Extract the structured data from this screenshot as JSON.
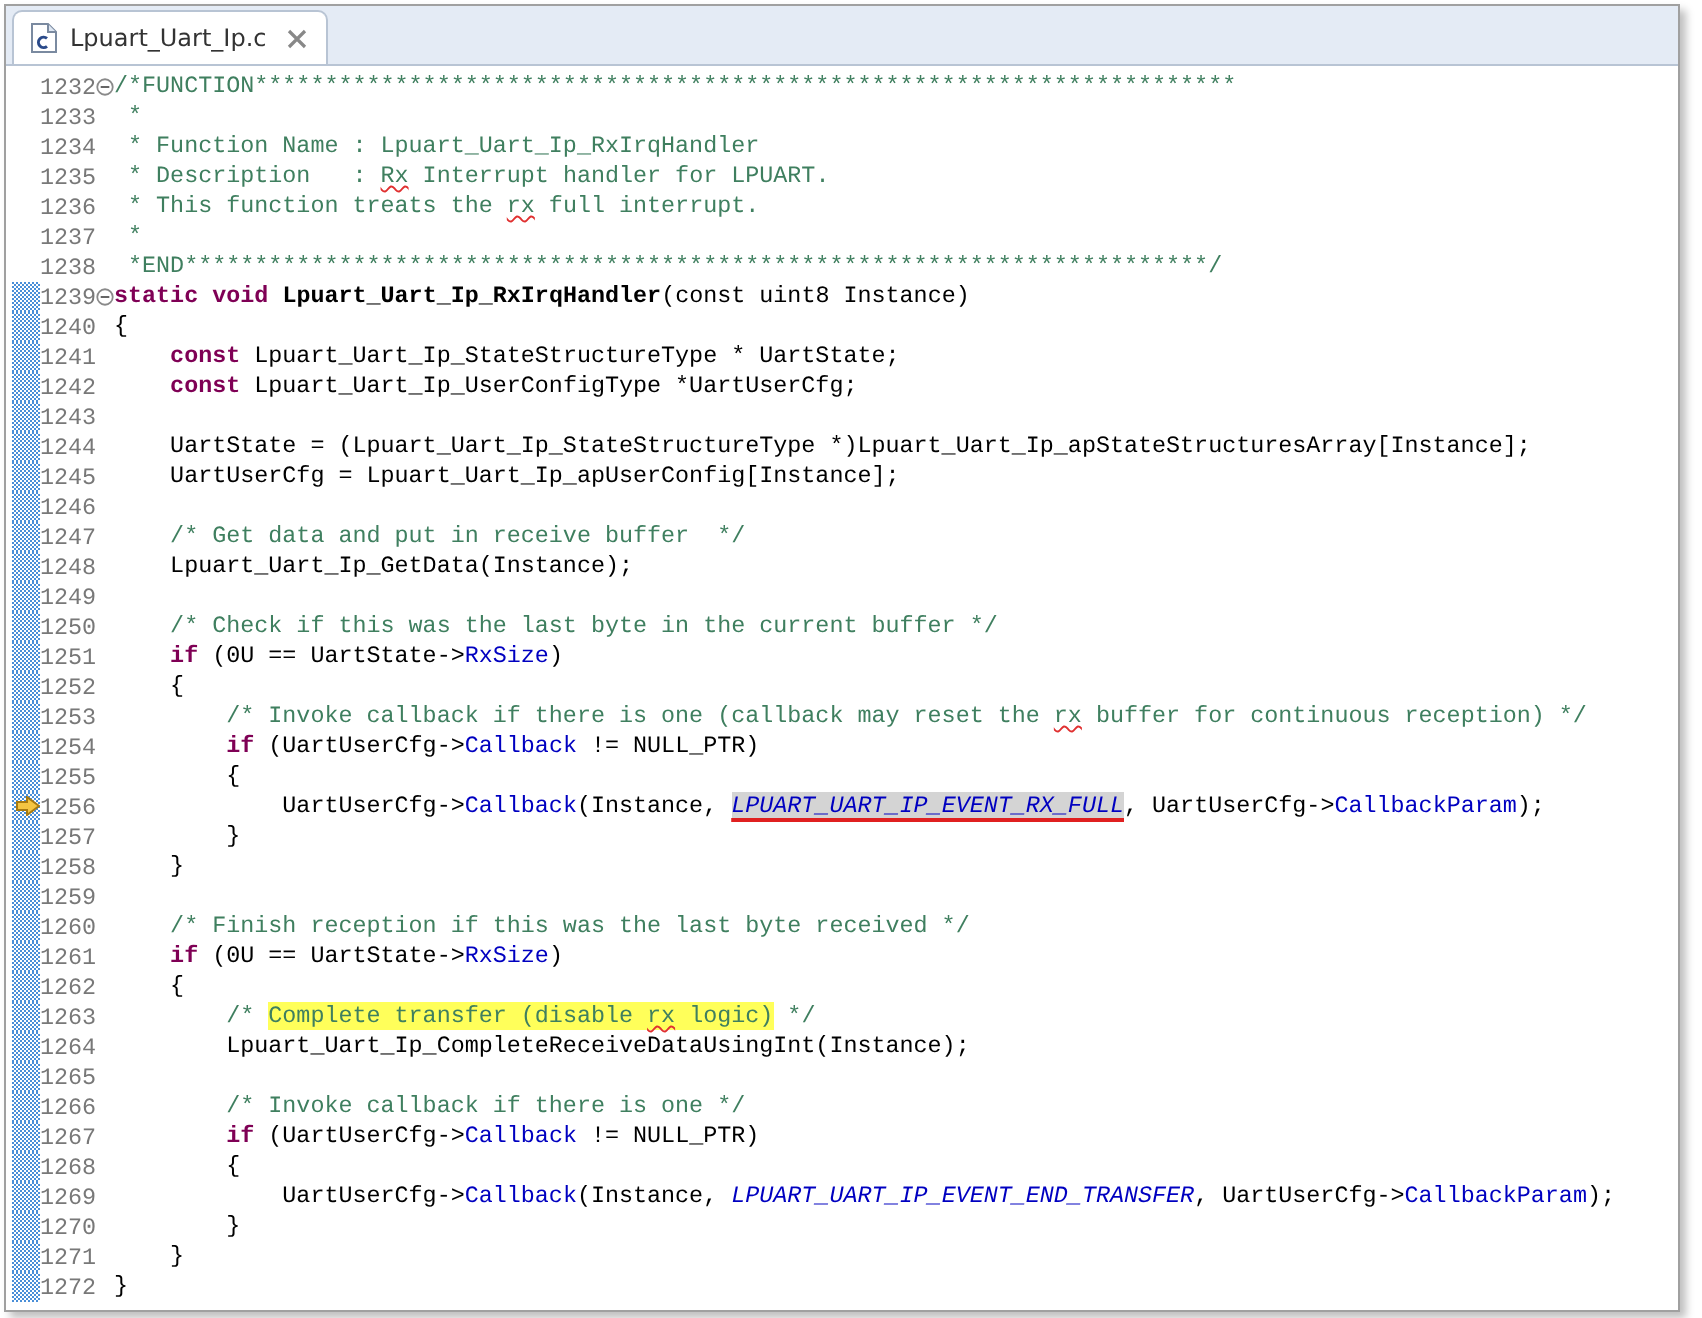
{
  "tabs": [
    {
      "label": "Lpuart_Uart_Ip.c",
      "selected": true
    }
  ],
  "editor": {
    "lines": [
      {
        "number": "1232",
        "fold": true,
        "changed": false,
        "current": false,
        "tokens": [
          {
            "kind": "comment",
            "text": "/*FUNCTION**********************************************************************"
          }
        ]
      },
      {
        "number": "1233",
        "fold": false,
        "changed": false,
        "current": false,
        "tokens": [
          {
            "kind": "comment",
            "text": " *"
          }
        ]
      },
      {
        "number": "1234",
        "fold": false,
        "changed": false,
        "current": false,
        "tokens": [
          {
            "kind": "comment",
            "text": " * Function Name : Lpuart_Uart_Ip_RxIrqHandler"
          }
        ]
      },
      {
        "number": "1235",
        "fold": false,
        "changed": false,
        "current": false,
        "tokens": [
          {
            "kind": "comment",
            "text": " * Description   : "
          },
          {
            "kind": "comment-squiggle",
            "text": "Rx"
          },
          {
            "kind": "comment",
            "text": " Interrupt handler for LPUART."
          }
        ]
      },
      {
        "number": "1236",
        "fold": false,
        "changed": false,
        "current": false,
        "tokens": [
          {
            "kind": "comment",
            "text": " * This function treats the "
          },
          {
            "kind": "comment-squiggle",
            "text": "rx"
          },
          {
            "kind": "comment",
            "text": " full interrupt."
          }
        ]
      },
      {
        "number": "1237",
        "fold": false,
        "changed": false,
        "current": false,
        "tokens": [
          {
            "kind": "comment",
            "text": " *"
          }
        ]
      },
      {
        "number": "1238",
        "fold": false,
        "changed": false,
        "current": false,
        "tokens": [
          {
            "kind": "comment",
            "text": " *END*************************************************************************/"
          }
        ]
      },
      {
        "number": "1239",
        "fold": true,
        "changed": true,
        "current": false,
        "tokens": [
          {
            "kind": "keyword",
            "text": "static "
          },
          {
            "kind": "keyword",
            "text": "void "
          },
          {
            "kind": "function",
            "text": "Lpuart_Uart_Ip_RxIrqHandler"
          },
          {
            "kind": "plain",
            "text": "(const uint8 Instance)"
          }
        ]
      },
      {
        "number": "1240",
        "fold": false,
        "changed": true,
        "current": false,
        "tokens": [
          {
            "kind": "plain",
            "text": "{"
          }
        ]
      },
      {
        "number": "1241",
        "fold": false,
        "changed": true,
        "current": false,
        "tokens": [
          {
            "kind": "keyword",
            "text": "    const"
          },
          {
            "kind": "plain",
            "text": " Lpuart_Uart_Ip_StateStructureType * UartState;"
          }
        ]
      },
      {
        "number": "1242",
        "fold": false,
        "changed": true,
        "current": false,
        "tokens": [
          {
            "kind": "keyword",
            "text": "    const"
          },
          {
            "kind": "plain",
            "text": " Lpuart_Uart_Ip_UserConfigType *UartUserCfg;"
          }
        ]
      },
      {
        "number": "1243",
        "fold": false,
        "changed": true,
        "current": false
      },
      {
        "number": "1244",
        "fold": false,
        "changed": true,
        "current": false,
        "tokens": [
          {
            "kind": "plain",
            "text": "    UartState = (Lpuart_Uart_Ip_StateStructureType *)Lpuart_Uart_Ip_apStateStructuresArray[Instance];"
          }
        ]
      },
      {
        "number": "1245",
        "fold": false,
        "changed": true,
        "current": false,
        "tokens": [
          {
            "kind": "plain",
            "text": "    UartUserCfg = Lpuart_Uart_Ip_apUserConfig[Instance];"
          }
        ]
      },
      {
        "number": "1246",
        "fold": false,
        "changed": true,
        "current": false
      },
      {
        "number": "1247",
        "fold": false,
        "changed": true,
        "current": false,
        "tokens": [
          {
            "kind": "comment",
            "text": "    /* Get data and put in receive buffer  */"
          }
        ]
      },
      {
        "number": "1248",
        "fold": false,
        "changed": true,
        "current": false,
        "tokens": [
          {
            "kind": "plain",
            "text": "    Lpuart_Uart_Ip_GetData(Instance);"
          }
        ]
      },
      {
        "number": "1249",
        "fold": false,
        "changed": true,
        "current": false
      },
      {
        "number": "1250",
        "fold": false,
        "changed": true,
        "current": false,
        "tokens": [
          {
            "kind": "comment",
            "text": "    /* Check if this was the last byte in the current buffer */"
          }
        ]
      },
      {
        "number": "1251",
        "fold": false,
        "changed": true,
        "current": false,
        "tokens": [
          {
            "kind": "keyword",
            "text": "    if"
          },
          {
            "kind": "plain",
            "text": " (0U == UartState->"
          },
          {
            "kind": "field",
            "text": "RxSize"
          },
          {
            "kind": "plain",
            "text": ")"
          }
        ]
      },
      {
        "number": "1252",
        "fold": false,
        "changed": true,
        "current": false,
        "tokens": [
          {
            "kind": "plain",
            "text": "    {"
          }
        ]
      },
      {
        "number": "1253",
        "fold": false,
        "changed": true,
        "current": false,
        "tokens": [
          {
            "kind": "comment",
            "text": "        /* Invoke callback if there is one (callback may reset the "
          },
          {
            "kind": "comment-squiggle",
            "text": "rx"
          },
          {
            "kind": "comment",
            "text": " buffer for continuous reception) */"
          }
        ]
      },
      {
        "number": "1254",
        "fold": false,
        "changed": true,
        "current": false,
        "tokens": [
          {
            "kind": "keyword",
            "text": "        if"
          },
          {
            "kind": "plain",
            "text": " (UartUserCfg->"
          },
          {
            "kind": "field",
            "text": "Callback"
          },
          {
            "kind": "plain",
            "text": " != NULL_PTR)"
          }
        ]
      },
      {
        "number": "1255",
        "fold": false,
        "changed": true,
        "current": false,
        "tokens": [
          {
            "kind": "plain",
            "text": "        {"
          }
        ]
      },
      {
        "number": "1256",
        "fold": false,
        "changed": true,
        "current": true,
        "tokens": [
          {
            "kind": "plain",
            "text": "            UartUserCfg->"
          },
          {
            "kind": "field",
            "text": "Callback"
          },
          {
            "kind": "plain",
            "text": "(Instance, "
          },
          {
            "kind": "macro-selected",
            "text": "LPUART_UART_IP_EVENT_RX_FULL"
          },
          {
            "kind": "plain",
            "text": ", UartUserCfg->"
          },
          {
            "kind": "field",
            "text": "CallbackParam"
          },
          {
            "kind": "plain",
            "text": ");"
          }
        ]
      },
      {
        "number": "1257",
        "fold": false,
        "changed": true,
        "current": false,
        "tokens": [
          {
            "kind": "plain",
            "text": "        }"
          }
        ]
      },
      {
        "number": "1258",
        "fold": false,
        "changed": true,
        "current": false,
        "tokens": [
          {
            "kind": "plain",
            "text": "    }"
          }
        ]
      },
      {
        "number": "1259",
        "fold": false,
        "changed": true,
        "current": false
      },
      {
        "number": "1260",
        "fold": false,
        "changed": true,
        "current": false,
        "tokens": [
          {
            "kind": "comment",
            "text": "    /* Finish reception if this was the last byte received */"
          }
        ]
      },
      {
        "number": "1261",
        "fold": false,
        "changed": true,
        "current": false,
        "tokens": [
          {
            "kind": "keyword",
            "text": "    if"
          },
          {
            "kind": "plain",
            "text": " (0U == UartState->"
          },
          {
            "kind": "field",
            "text": "RxSize"
          },
          {
            "kind": "plain",
            "text": ")"
          }
        ]
      },
      {
        "number": "1262",
        "fold": false,
        "changed": true,
        "current": false,
        "tokens": [
          {
            "kind": "plain",
            "text": "    {"
          }
        ]
      },
      {
        "number": "1263",
        "fold": false,
        "changed": true,
        "current": false,
        "tokens": [
          {
            "kind": "comment",
            "text": "        /* "
          },
          {
            "kind": "comment-highlight",
            "text": "Complete transfer (disable "
          },
          {
            "kind": "comment-highlight-squiggle",
            "text": "rx"
          },
          {
            "kind": "comment-highlight",
            "text": " logic)"
          },
          {
            "kind": "comment",
            "text": " */"
          }
        ]
      },
      {
        "number": "1264",
        "fold": false,
        "changed": true,
        "current": false,
        "tokens": [
          {
            "kind": "plain",
            "text": "        Lpuart_Uart_Ip_CompleteReceiveDataUsingInt(Instance);"
          }
        ]
      },
      {
        "number": "1265",
        "fold": false,
        "changed": true,
        "current": false
      },
      {
        "number": "1266",
        "fold": false,
        "changed": true,
        "current": false,
        "tokens": [
          {
            "kind": "comment",
            "text": "        /* Invoke callback if there is one */"
          }
        ]
      },
      {
        "number": "1267",
        "fold": false,
        "changed": true,
        "current": false,
        "tokens": [
          {
            "kind": "keyword",
            "text": "        if"
          },
          {
            "kind": "plain",
            "text": " (UartUserCfg->"
          },
          {
            "kind": "field",
            "text": "Callback"
          },
          {
            "kind": "plain",
            "text": " != NULL_PTR)"
          }
        ]
      },
      {
        "number": "1268",
        "fold": false,
        "changed": true,
        "current": false,
        "tokens": [
          {
            "kind": "plain",
            "text": "        {"
          }
        ]
      },
      {
        "number": "1269",
        "fold": false,
        "changed": true,
        "current": false,
        "tokens": [
          {
            "kind": "plain",
            "text": "            UartUserCfg->"
          },
          {
            "kind": "field",
            "text": "Callback"
          },
          {
            "kind": "plain",
            "text": "(Instance, "
          },
          {
            "kind": "macro",
            "text": "LPUART_UART_IP_EVENT_END_TRANSFER"
          },
          {
            "kind": "plain",
            "text": ", UartUserCfg->"
          },
          {
            "kind": "field",
            "text": "CallbackParam"
          },
          {
            "kind": "plain",
            "text": ");"
          }
        ]
      },
      {
        "number": "1270",
        "fold": false,
        "changed": true,
        "current": false,
        "tokens": [
          {
            "kind": "plain",
            "text": "        }"
          }
        ]
      },
      {
        "number": "1271",
        "fold": false,
        "changed": true,
        "current": false,
        "tokens": [
          {
            "kind": "plain",
            "text": "    }"
          }
        ]
      },
      {
        "number": "1272",
        "fold": false,
        "changed": true,
        "current": false,
        "tokens": [
          {
            "kind": "plain",
            "text": "}"
          }
        ]
      }
    ]
  }
}
